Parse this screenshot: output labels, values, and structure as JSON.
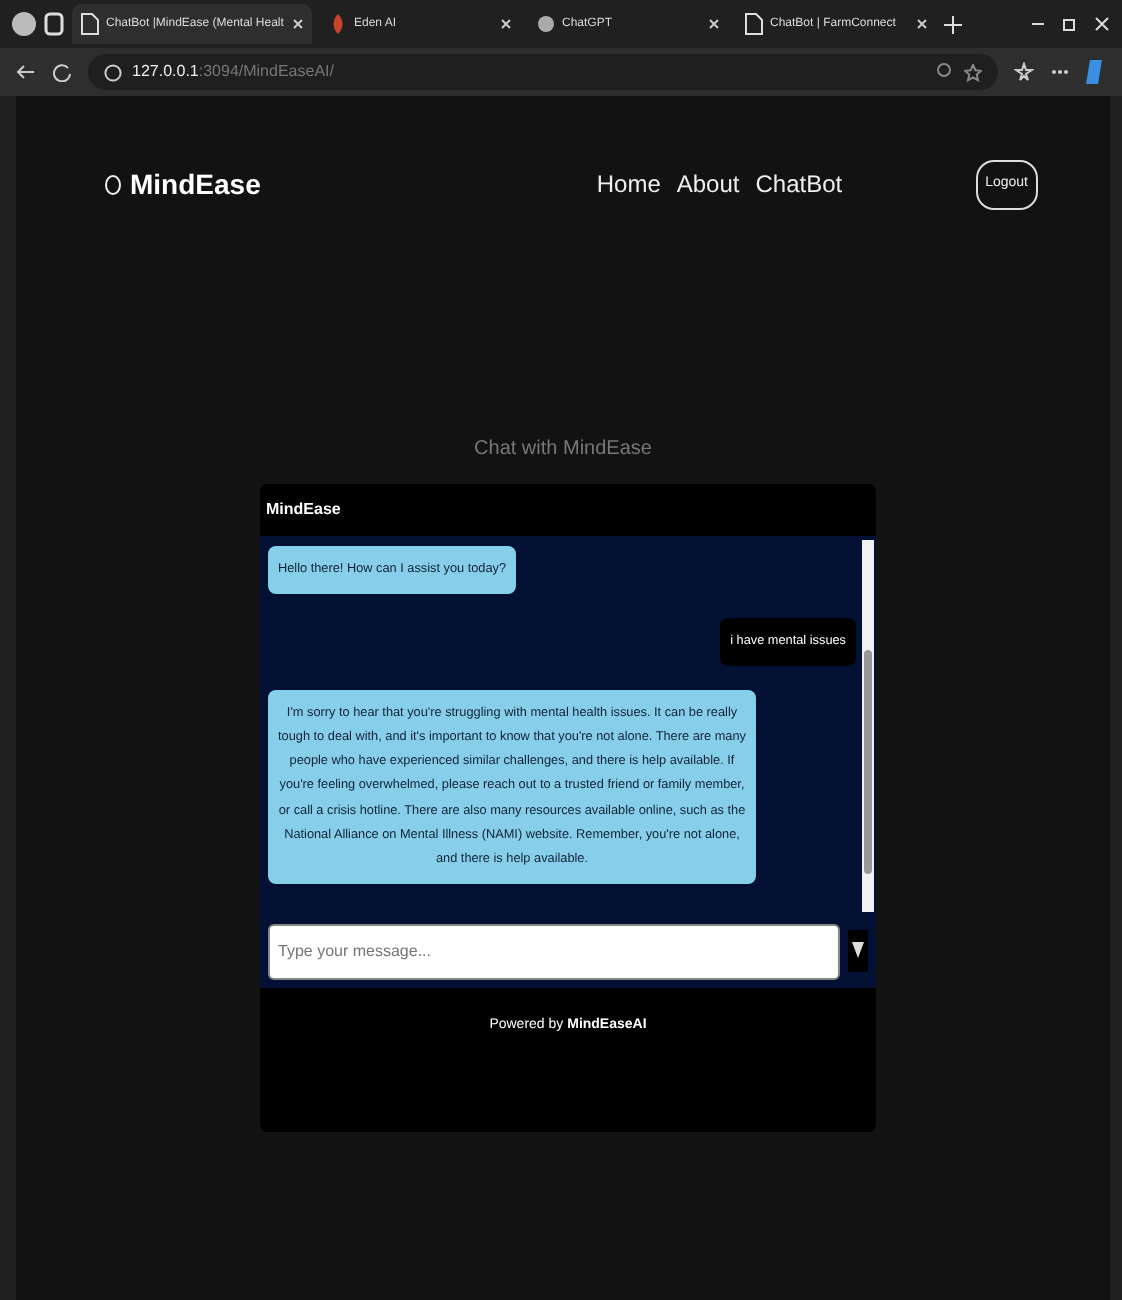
{
  "browser": {
    "tabs": [
      {
        "title": "ChatBot |MindEase (Mental Healt",
        "selected": true
      },
      {
        "title": "Eden AI",
        "selected": false
      },
      {
        "title": "ChatGPT",
        "selected": false
      },
      {
        "title": "ChatBot | FarmConnect",
        "selected": false
      }
    ],
    "address": {
      "host": "127.0.0.1",
      "path": ":3094/MindEaseAI/"
    }
  },
  "navbar": {
    "brand": "MindEase",
    "links": [
      "Home",
      "About",
      "ChatBot"
    ],
    "logout": "Logout"
  },
  "chat": {
    "heading": "Chat with MindEase",
    "header": "MindEase",
    "messages": [
      {
        "kind": "bot",
        "text": "Hello there! How can I assist you today?"
      },
      {
        "kind": "user",
        "text": "i have mental issues"
      },
      {
        "kind": "bot",
        "text": "I'm sorry to hear that you're struggling with mental health issues. It can be really tough to deal with, and it's important to know that you're not alone. There are many people who have experienced similar challenges, and there is help available. If you're feeling overwhelmed, please reach out to a trusted friend or family member, or call a crisis hotline. There are also many resources available online, such as the National Alliance on Mental Illness (NAMI) website. Remember, you're not alone, and there is help available."
      }
    ],
    "input": {
      "placeholder": "Type your message..."
    },
    "footer": "Powered by **MindEaseAI**"
  }
}
